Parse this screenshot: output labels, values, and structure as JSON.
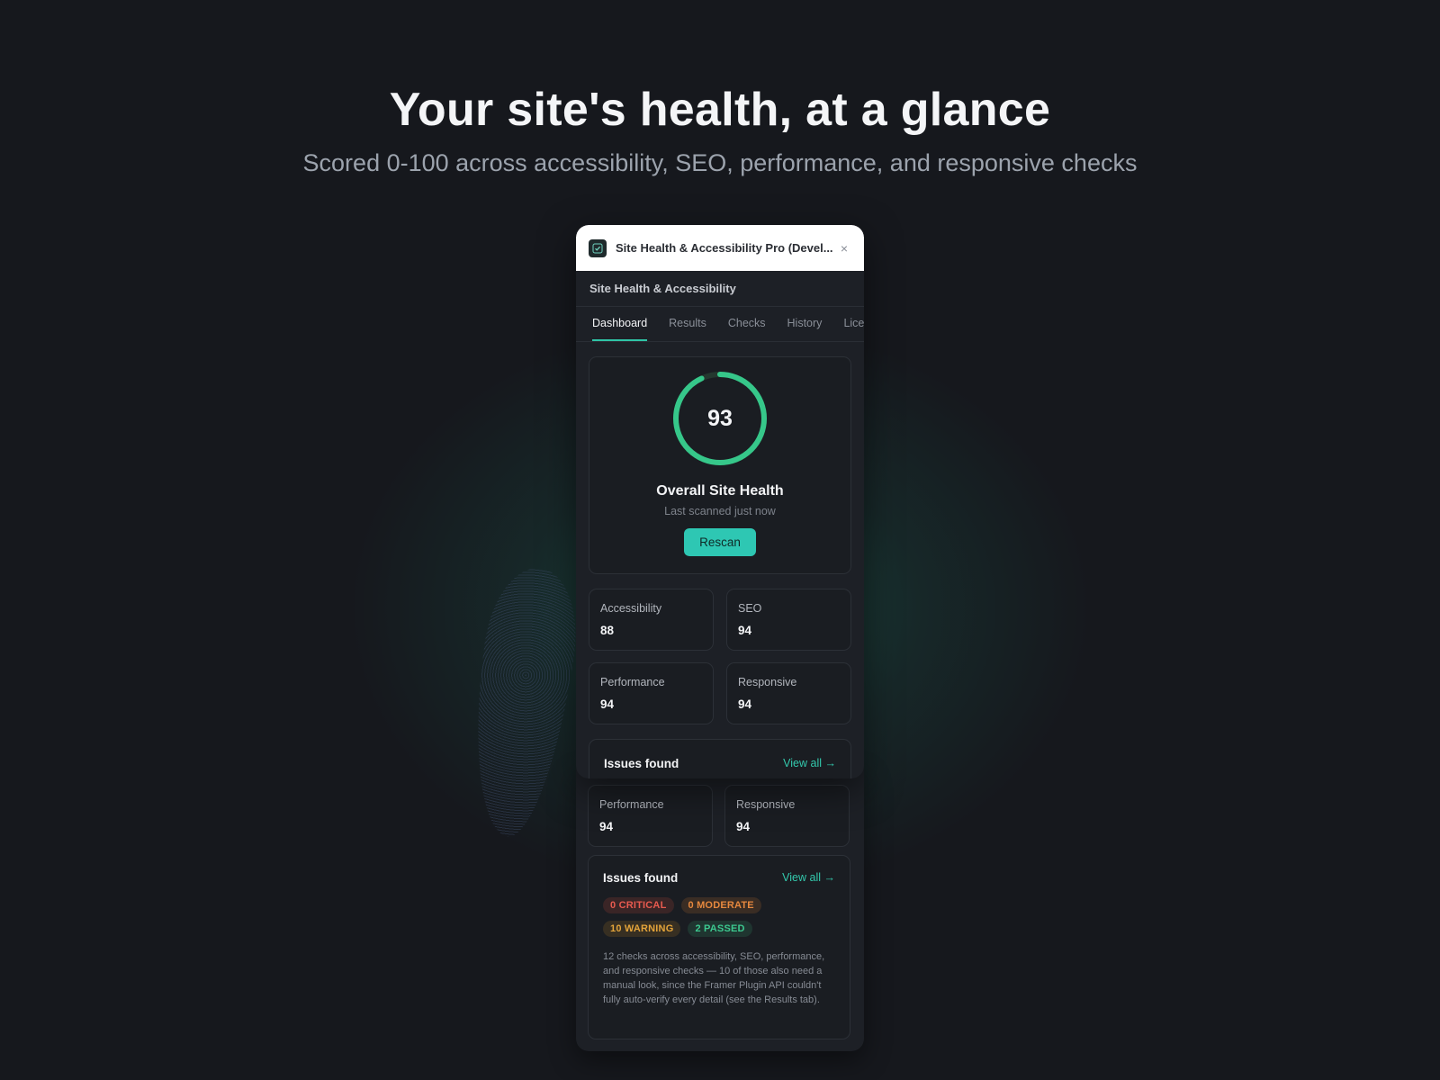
{
  "hero": {
    "title": "Your site's health, at a glance",
    "subtitle": "Scored 0-100 across accessibility, SEO, performance, and responsive checks"
  },
  "window": {
    "title": "Site Health & Accessibility Pro (Devel...",
    "close_label": "×",
    "header": "Site Health & Accessibility"
  },
  "tabs": [
    {
      "label": "Dashboard",
      "active": true
    },
    {
      "label": "Results",
      "active": false
    },
    {
      "label": "Checks",
      "active": false
    },
    {
      "label": "History",
      "active": false
    },
    {
      "label": "Licen",
      "active": false
    }
  ],
  "overall": {
    "score": "93",
    "score_fraction": 0.93,
    "title": "Overall Site Health",
    "last_scanned": "Last scanned just now",
    "rescan_label": "Rescan"
  },
  "metrics": [
    {
      "label": "Accessibility",
      "value": "88"
    },
    {
      "label": "SEO",
      "value": "94"
    },
    {
      "label": "Performance",
      "value": "94"
    },
    {
      "label": "Responsive",
      "value": "94"
    }
  ],
  "issues": {
    "title": "Issues found",
    "view_all": "View all →",
    "badges": {
      "critical": "0 CRITICAL",
      "moderate": "0 MODERATE",
      "warning": "10 WARNING",
      "passed": "2 PASSED"
    },
    "description": "12 checks across accessibility, SEO, performance, and responsive checks — 10 of those also need a manual look, since the Framer Plugin API couldn't fully auto-verify every detail (see the Results tab)."
  },
  "colors": {
    "accent": "#2fc4a6",
    "ring": "#36c78a",
    "critical": "#e85a4f",
    "moderate": "#e6883e",
    "warning": "#e4a43a",
    "passed": "#3cc88f"
  },
  "icons": {
    "app": "check-shield-icon",
    "close": "close-icon",
    "arrow": "arrow-right-icon"
  }
}
